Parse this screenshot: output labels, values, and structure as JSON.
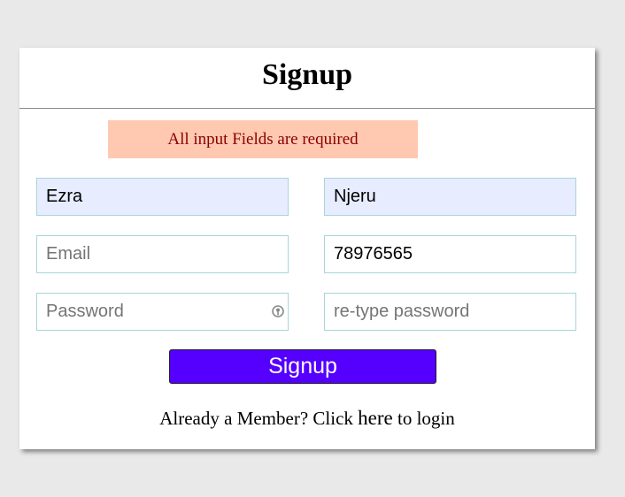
{
  "form": {
    "title": "Signup",
    "alert": "All input Fields are required",
    "first_name": {
      "value": "Ezra",
      "placeholder": ""
    },
    "last_name": {
      "value": "Njeru",
      "placeholder": ""
    },
    "email": {
      "value": "",
      "placeholder": "Email"
    },
    "phone": {
      "value": "78976565",
      "placeholder": ""
    },
    "password": {
      "value": "",
      "placeholder": "Password"
    },
    "retype_password": {
      "value": "",
      "placeholder": "re-type password"
    },
    "submit_label": "Signup"
  },
  "footer": {
    "prefix": "Already a Member? Click",
    "link": "here",
    "suffix": "to login"
  },
  "colors": {
    "alert_bg": "#ffc8b0",
    "alert_text": "#8b0000",
    "autofill_bg": "#e8ecff",
    "button_bg": "#5500ff"
  },
  "icons": {
    "password_field": "key-icon"
  }
}
